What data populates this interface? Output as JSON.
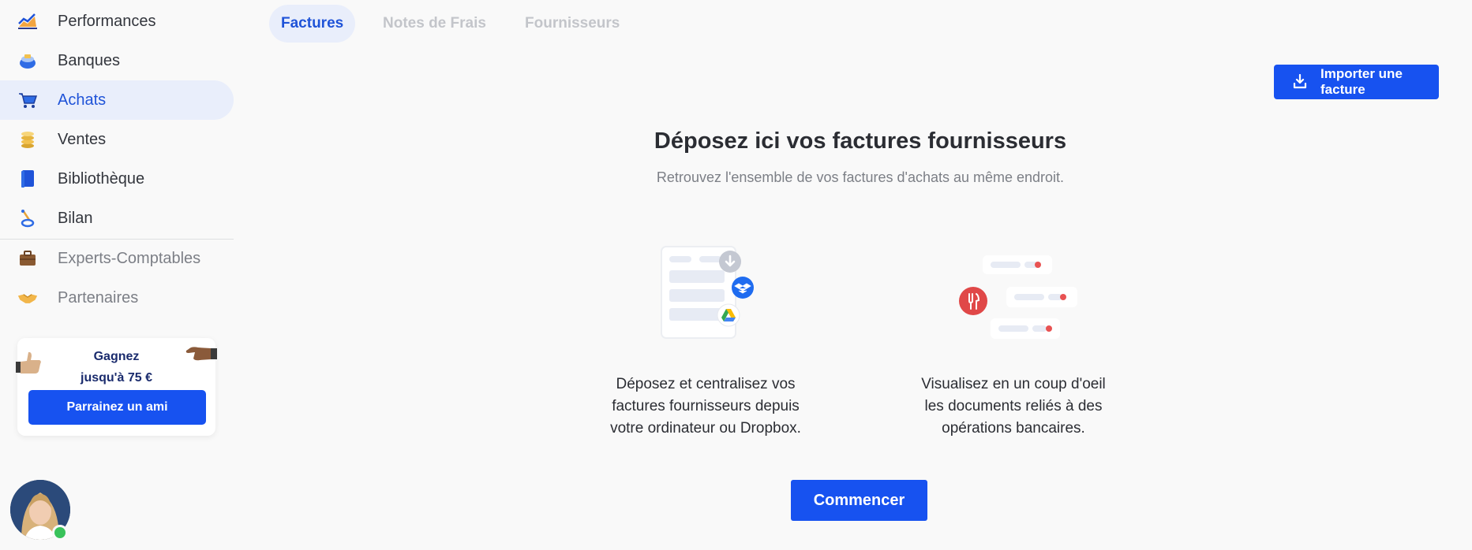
{
  "sidebar": {
    "items": [
      {
        "label": "Performances",
        "icon": "chart-icon",
        "active": false
      },
      {
        "label": "Banques",
        "icon": "bank-icon",
        "active": false
      },
      {
        "label": "Achats",
        "icon": "cart-icon",
        "active": true
      },
      {
        "label": "Ventes",
        "icon": "coins-icon",
        "active": false
      },
      {
        "label": "Bibliothèque",
        "icon": "book-icon",
        "active": false
      },
      {
        "label": "Bilan",
        "icon": "balance-icon",
        "active": false
      },
      {
        "label": "Experts-Comptables",
        "icon": "briefcase-icon",
        "active": false
      },
      {
        "label": "Partenaires",
        "icon": "handshake-icon",
        "active": false
      }
    ],
    "referral": {
      "title_line1": "Gagnez",
      "title_line2": "jusqu'à 75 €",
      "button": "Parrainez un ami"
    }
  },
  "tabs": [
    {
      "label": "Factures",
      "active": true
    },
    {
      "label": "Notes de Frais",
      "active": false
    },
    {
      "label": "Fournisseurs",
      "active": false
    }
  ],
  "toolbar": {
    "import_label": "Importer une facture"
  },
  "main": {
    "title": "Déposez ici vos factures fournisseurs",
    "subtitle": "Retrouvez l'ensemble de vos factures d'achats au même endroit.",
    "features": [
      {
        "line1": "Déposez et centralisez vos",
        "line2": "factures fournisseurs depuis",
        "line3": "votre ordinateur ou Dropbox."
      },
      {
        "line1": "Visualisez en un coup d'oeil",
        "line2": "les documents reliés à des",
        "line3": "opérations bancaires."
      }
    ],
    "cta": "Commencer"
  },
  "colors": {
    "accent": "#1752f0",
    "active_bg": "#e9eefb",
    "active_text": "#1f53d8",
    "background": "#f9f9f9",
    "online": "#39c25a"
  }
}
